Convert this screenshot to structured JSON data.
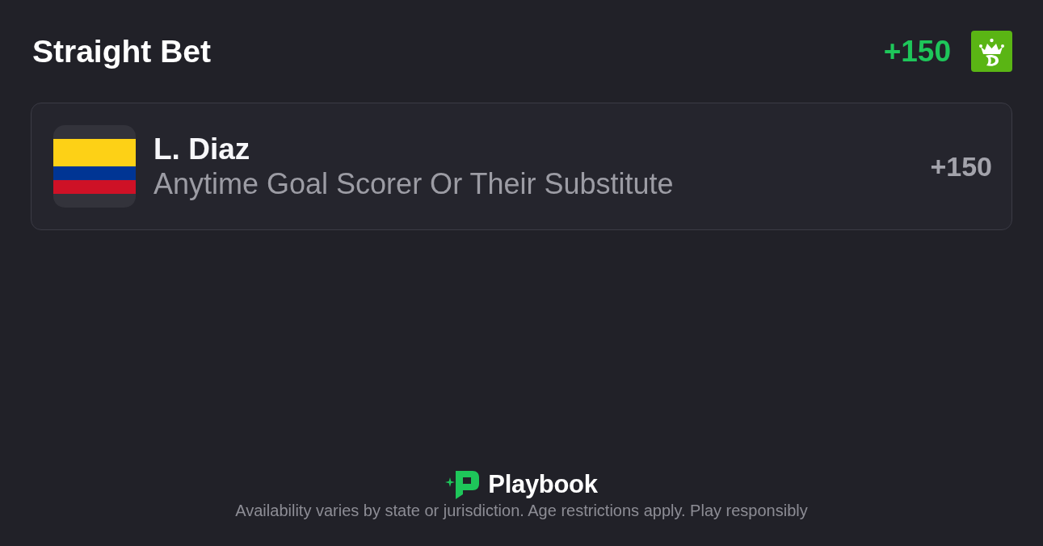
{
  "header": {
    "title": "Straight Bet",
    "odds": "+150"
  },
  "selections": [
    {
      "player": "L. Diaz",
      "market": "Anytime Goal Scorer Or Their Substitute",
      "odds": "+150"
    }
  ],
  "footer": {
    "brand": "Playbook",
    "disclaimer": "Availability varies by state or jurisdiction. Age restrictions apply. Play responsibly"
  }
}
